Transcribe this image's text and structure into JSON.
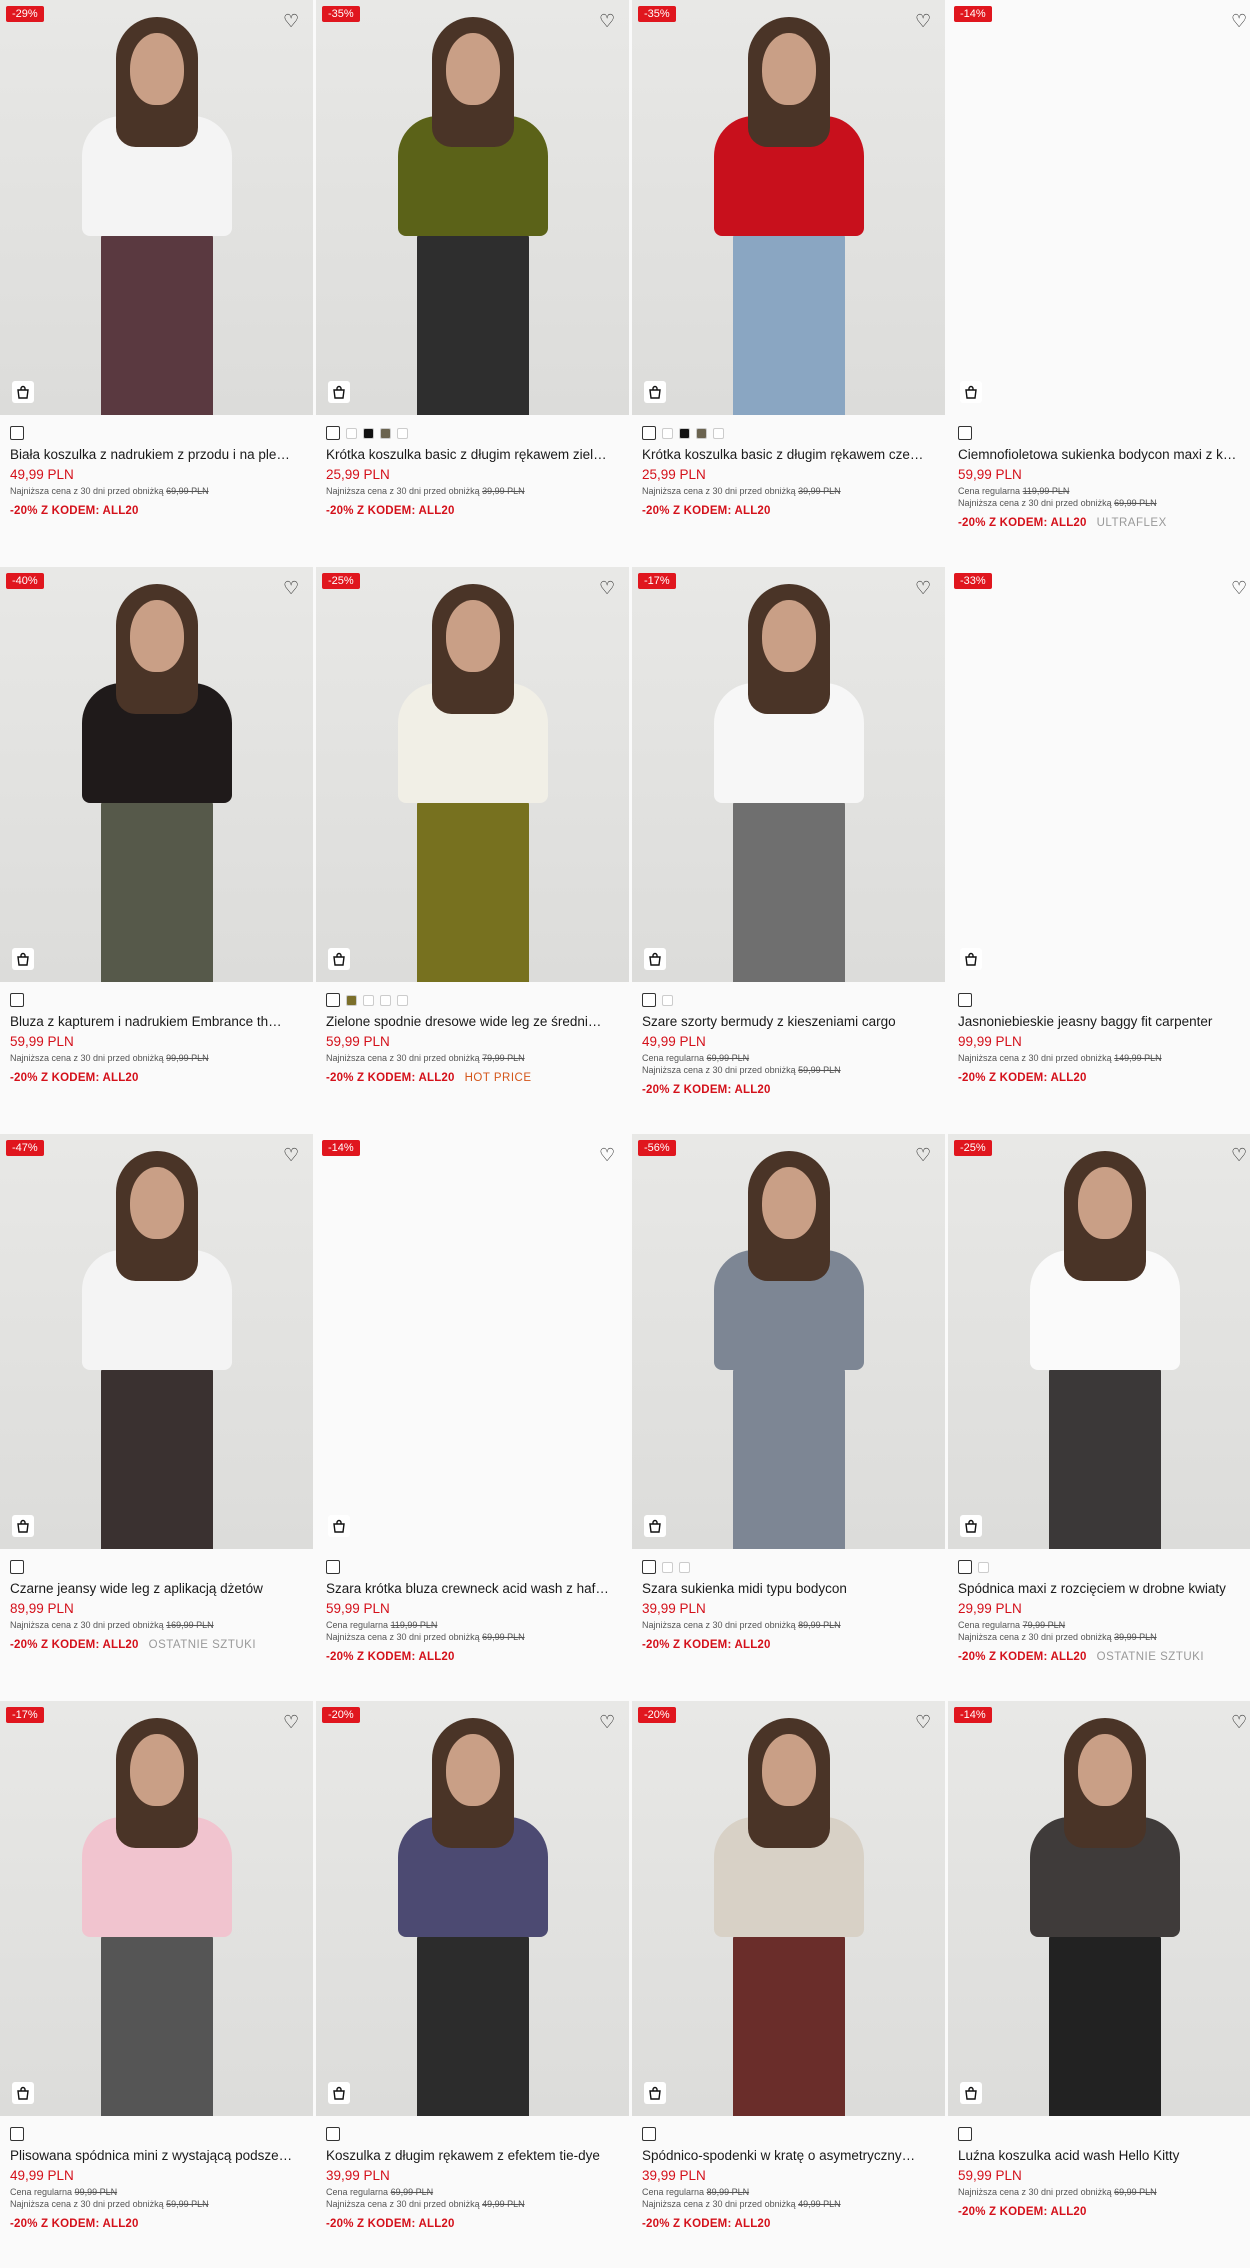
{
  "products": [
    {
      "badge": "-29%",
      "name": "Biała koszulka z nadrukiem z przodu i na ple…",
      "price": "49,99 PLN",
      "regular": "",
      "lowest_label": "Najniższa cena z 30 dni przed obniżką",
      "lowest": "69,99 PLN",
      "promo": "-20% Z KODEM: ALL20",
      "tag": "",
      "colors": [],
      "image": "model",
      "top": "#f4f4f4",
      "bottom": "#5a3940"
    },
    {
      "badge": "-35%",
      "name": "Krótka koszulka basic z długim rękawem ziel…",
      "price": "25,99 PLN",
      "regular": "",
      "lowest_label": "Najniższa cena z 30 dni przed obniżką",
      "lowest": "39,99 PLN",
      "promo": "-20% Z KODEM: ALL20",
      "tag": "",
      "colors": [
        "#ffffff",
        "#111111",
        "#6b6450",
        "#ffffff"
      ],
      "image": "model",
      "top": "#5b6218",
      "bottom": "#2e2e2e"
    },
    {
      "badge": "-35%",
      "name": "Krótka koszulka basic z długim rękawem cze…",
      "price": "25,99 PLN",
      "regular": "",
      "lowest_label": "Najniższa cena z 30 dni przed obniżką",
      "lowest": "39,99 PLN",
      "promo": "-20% Z KODEM: ALL20",
      "tag": "",
      "colors": [
        "#ffffff",
        "#111111",
        "#6b6450",
        "#ffffff"
      ],
      "image": "model",
      "top": "#c8101c",
      "bottom": "#8aa6c2"
    },
    {
      "badge": "-14%",
      "name": "Ciemnofioletowa sukienka bodycon maxi z k…",
      "price": "59,99 PLN",
      "regular_label": "Cena regularna",
      "regular": "119,99 PLN",
      "lowest_label": "Najniższa cena z 30 dni przed obniżką",
      "lowest": "69,99 PLN",
      "promo": "-20% Z KODEM: ALL20",
      "tag": "ULTRAFLEX",
      "colors": [],
      "image": "blank"
    },
    {
      "badge": "-40%",
      "name": "Bluza z kapturem i nadrukiem Embrance th…",
      "price": "59,99 PLN",
      "regular": "",
      "lowest_label": "Najniższa cena z 30 dni przed obniżką",
      "lowest": "99,99 PLN",
      "promo": "-20% Z KODEM: ALL20",
      "tag": "",
      "colors": [],
      "image": "model",
      "top": "#1f1a1a",
      "bottom": "#56594a"
    },
    {
      "badge": "-25%",
      "name": "Zielone spodnie dresowe wide leg ze średni…",
      "price": "59,99 PLN",
      "regular": "",
      "lowest_label": "Najniższa cena z 30 dni przed obniżką",
      "lowest": "79,99 PLN",
      "promo": "-20% Z KODEM: ALL20",
      "tag": "HOT PRICE",
      "tag_hot": true,
      "colors": [
        "#7b6f2a",
        "#ffffff",
        "#ffffff",
        "#ffffff"
      ],
      "image": "model",
      "top": "#f1efe6",
      "bottom": "#77711f"
    },
    {
      "badge": "-17%",
      "name": "Szare szorty bermudy z kieszeniami cargo",
      "price": "49,99 PLN",
      "regular_label": "Cena regularna",
      "regular": "69,99 PLN",
      "lowest_label": "Najniższa cena z 30 dni przed obniżką",
      "lowest": "59,99 PLN",
      "promo": "-20% Z KODEM: ALL20",
      "tag": "",
      "colors": [
        "#ffffff"
      ],
      "image": "model",
      "top": "#f7f7f7",
      "bottom": "#6f6f6f"
    },
    {
      "badge": "-33%",
      "name": "Jasnoniebieskie jeasny baggy fit carpenter",
      "price": "99,99 PLN",
      "regular": "",
      "lowest_label": "Najniższa cena z 30 dni przed obniżką",
      "lowest": "149,99 PLN",
      "promo": "-20% Z KODEM: ALL20",
      "tag": "",
      "colors": [],
      "image": "blank"
    },
    {
      "badge": "-47%",
      "name": "Czarne jeansy wide leg z aplikacją dżetów",
      "price": "89,99 PLN",
      "regular": "",
      "lowest_label": "Najniższa cena z 30 dni przed obniżką",
      "lowest": "169,99 PLN",
      "promo": "-20% Z KODEM: ALL20",
      "tag": "OSTATNIE SZTUKI",
      "colors": [],
      "image": "model",
      "top": "#f4f4f4",
      "bottom": "#3a3130"
    },
    {
      "badge": "-14%",
      "name": "Szara krótka bluza crewneck acid wash z haf…",
      "price": "59,99 PLN",
      "regular_label": "Cena regularna",
      "regular": "119,99 PLN",
      "lowest_label": "Najniższa cena z 30 dni przed obniżką",
      "lowest": "69,99 PLN",
      "promo": "-20% Z KODEM: ALL20",
      "tag": "",
      "colors": [],
      "image": "blank"
    },
    {
      "badge": "-56%",
      "name": "Szara sukienka midi typu bodycon",
      "price": "39,99 PLN",
      "regular": "",
      "lowest_label": "Najniższa cena z 30 dni przed obniżką",
      "lowest": "89,99 PLN",
      "promo": "-20% Z KODEM: ALL20",
      "tag": "",
      "colors": [
        "#ffffff",
        "#ffffff"
      ],
      "image": "model",
      "top": "#7d8694",
      "bottom": "#7d8694"
    },
    {
      "badge": "-25%",
      "name": "Spódnica maxi z rozcięciem w drobne kwiaty",
      "price": "29,99 PLN",
      "regular_label": "Cena regularna",
      "regular": "79,99 PLN",
      "lowest_label": "Najniższa cena z 30 dni przed obniżką",
      "lowest": "39,99 PLN",
      "promo": "-20% Z KODEM: ALL20",
      "tag": "OSTATNIE SZTUKI",
      "colors": [
        "#ffffff"
      ],
      "image": "model",
      "top": "#fafafa",
      "bottom": "#3b3838"
    },
    {
      "badge": "-17%",
      "name": "Plisowana spódnica mini z wystającą podsze…",
      "price": "49,99 PLN",
      "regular_label": "Cena regularna",
      "regular": "99,99 PLN",
      "lowest_label": "Najniższa cena z 30 dni przed obniżką",
      "lowest": "59,99 PLN",
      "promo": "-20% Z KODEM: ALL20",
      "tag": "",
      "colors": [],
      "image": "model",
      "top": "#f1c4cf",
      "bottom": "#555555"
    },
    {
      "badge": "-20%",
      "name": "Koszulka z długim rękawem z efektem tie-dye",
      "price": "39,99 PLN",
      "regular_label": "Cena regularna",
      "regular": "69,99 PLN",
      "lowest_label": "Najniższa cena z 30 dni przed obniżką",
      "lowest": "49,99 PLN",
      "promo": "-20% Z KODEM: ALL20",
      "tag": "",
      "colors": [],
      "image": "model",
      "top": "#4c4a72",
      "bottom": "#2c2c2c"
    },
    {
      "badge": "-20%",
      "name": "Spódnico-spodenki w kratę o asymetryczny…",
      "price": "39,99 PLN",
      "regular_label": "Cena regularna",
      "regular": "89,99 PLN",
      "lowest_label": "Najniższa cena z 30 dni przed obniżką",
      "lowest": "49,99 PLN",
      "promo": "-20% Z KODEM: ALL20",
      "tag": "",
      "colors": [],
      "image": "model",
      "top": "#d8d1c6",
      "bottom": "#6a2d2a"
    },
    {
      "badge": "-14%",
      "name": "Luźna koszulka acid wash Hello Kitty",
      "price": "59,99 PLN",
      "regular": "",
      "lowest_label": "Najniższa cena z 30 dni przed obniżką",
      "lowest": "69,99 PLN",
      "promo": "-20% Z KODEM: ALL20",
      "tag": "",
      "colors": [],
      "image": "model",
      "top": "#3f3b3a",
      "bottom": "#222222"
    }
  ]
}
